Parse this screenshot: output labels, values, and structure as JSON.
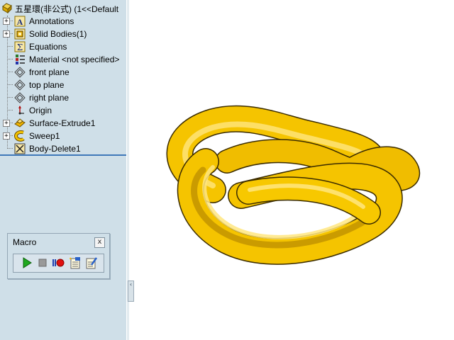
{
  "tree": {
    "root_label": "五星環(非公式)  (1<<Default",
    "items": [
      {
        "label": "Annotations",
        "icon": "annotations-icon",
        "expander": "+"
      },
      {
        "label": "Solid Bodies(1)",
        "icon": "solid-bodies-icon",
        "expander": "+"
      },
      {
        "label": "Equations",
        "icon": "equations-icon",
        "expander": ""
      },
      {
        "label": "Material <not specified>",
        "icon": "material-icon",
        "expander": ""
      },
      {
        "label": "front plane",
        "icon": "plane-icon",
        "expander": ""
      },
      {
        "label": "top plane",
        "icon": "plane-icon",
        "expander": ""
      },
      {
        "label": "right plane",
        "icon": "plane-icon",
        "expander": ""
      },
      {
        "label": "Origin",
        "icon": "origin-icon",
        "expander": ""
      },
      {
        "label": "Surface-Extrude1",
        "icon": "surface-extrude-icon",
        "expander": "+"
      },
      {
        "label": "Sweep1",
        "icon": "sweep-icon",
        "expander": "+"
      },
      {
        "label": "Body-Delete1",
        "icon": "body-delete-icon",
        "expander": ""
      }
    ]
  },
  "macro": {
    "title": "Macro",
    "close_glyph": "x",
    "buttons": [
      "run-macro",
      "stop-macro",
      "record-pause-macro",
      "new-macro",
      "edit-macro"
    ]
  },
  "collapse_glyph": "‹",
  "colors": {
    "panel_bg": "#cfdfe8",
    "separator": "#3f78b8",
    "model_gold": "#f5c400",
    "model_dark": "#b88a00",
    "model_light": "#ffe680"
  }
}
